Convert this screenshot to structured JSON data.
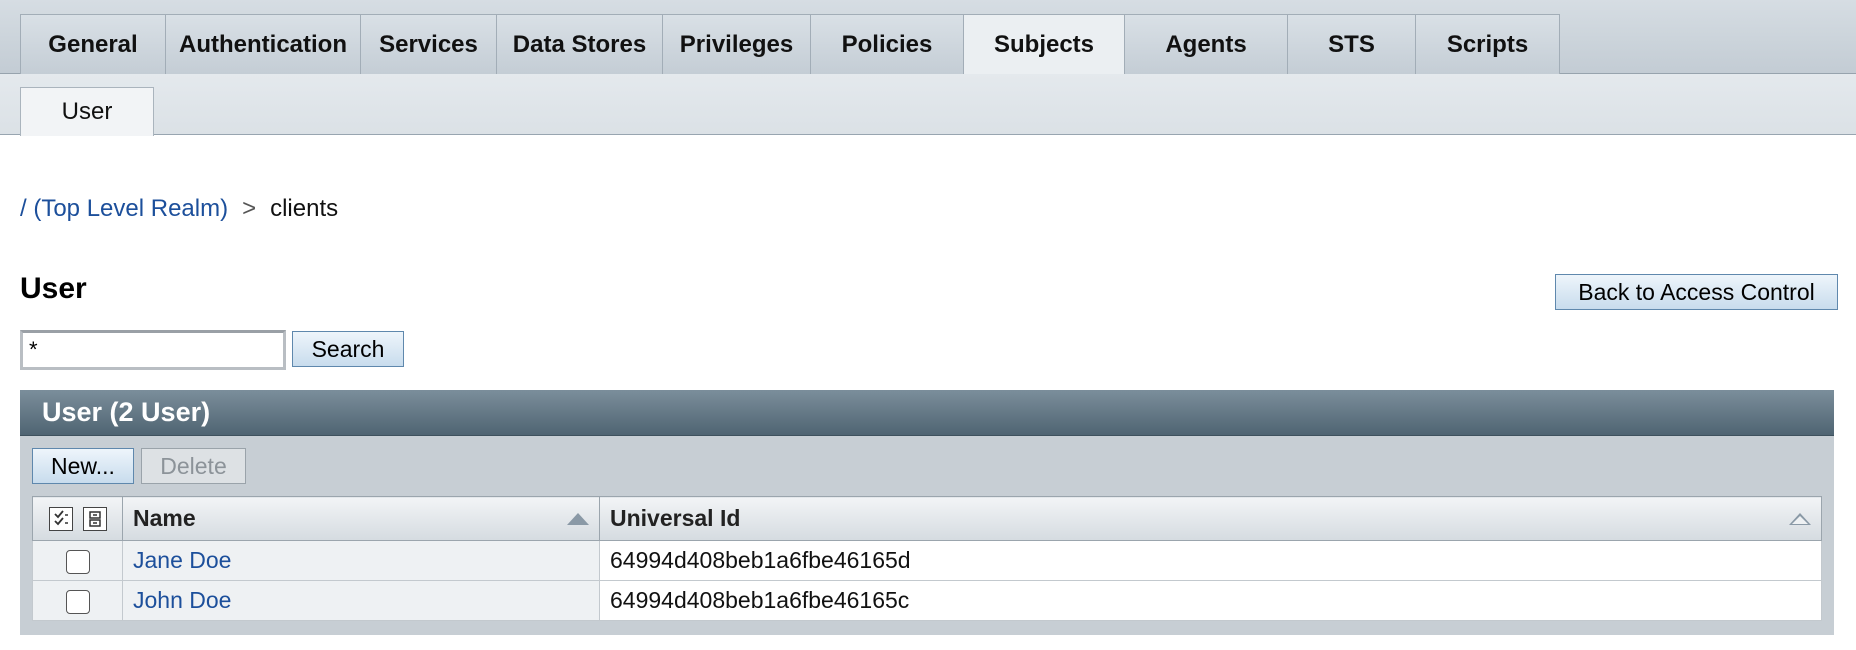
{
  "tabs": [
    {
      "label": "General",
      "active": false
    },
    {
      "label": "Authentication",
      "active": false
    },
    {
      "label": "Services",
      "active": false
    },
    {
      "label": "Data Stores",
      "active": false
    },
    {
      "label": "Privileges",
      "active": false
    },
    {
      "label": "Policies",
      "active": false
    },
    {
      "label": "Subjects",
      "active": true
    },
    {
      "label": "Agents",
      "active": false
    },
    {
      "label": "STS",
      "active": false
    },
    {
      "label": "Scripts",
      "active": false
    }
  ],
  "subtabs": [
    {
      "label": "User",
      "active": true
    }
  ],
  "breadcrumb": {
    "root": "/ (Top Level Realm)",
    "separator": ">",
    "current": "clients"
  },
  "page": {
    "title": "User",
    "back_button": "Back to Access Control"
  },
  "search": {
    "value": "*",
    "button": "Search"
  },
  "table": {
    "header": "User (2 User)",
    "new_button": "New...",
    "delete_button": "Delete",
    "columns": [
      "Name",
      "Universal Id"
    ],
    "rows": [
      {
        "name": "Jane Doe",
        "universal_id": "64994d408beb1a6fbe46165d"
      },
      {
        "name": "John Doe",
        "universal_id": "64994d408beb1a6fbe46165c"
      }
    ]
  },
  "colors": {
    "link": "#1c4f9b",
    "panel_header": "#4f6472",
    "button_border": "#5f88ad"
  }
}
